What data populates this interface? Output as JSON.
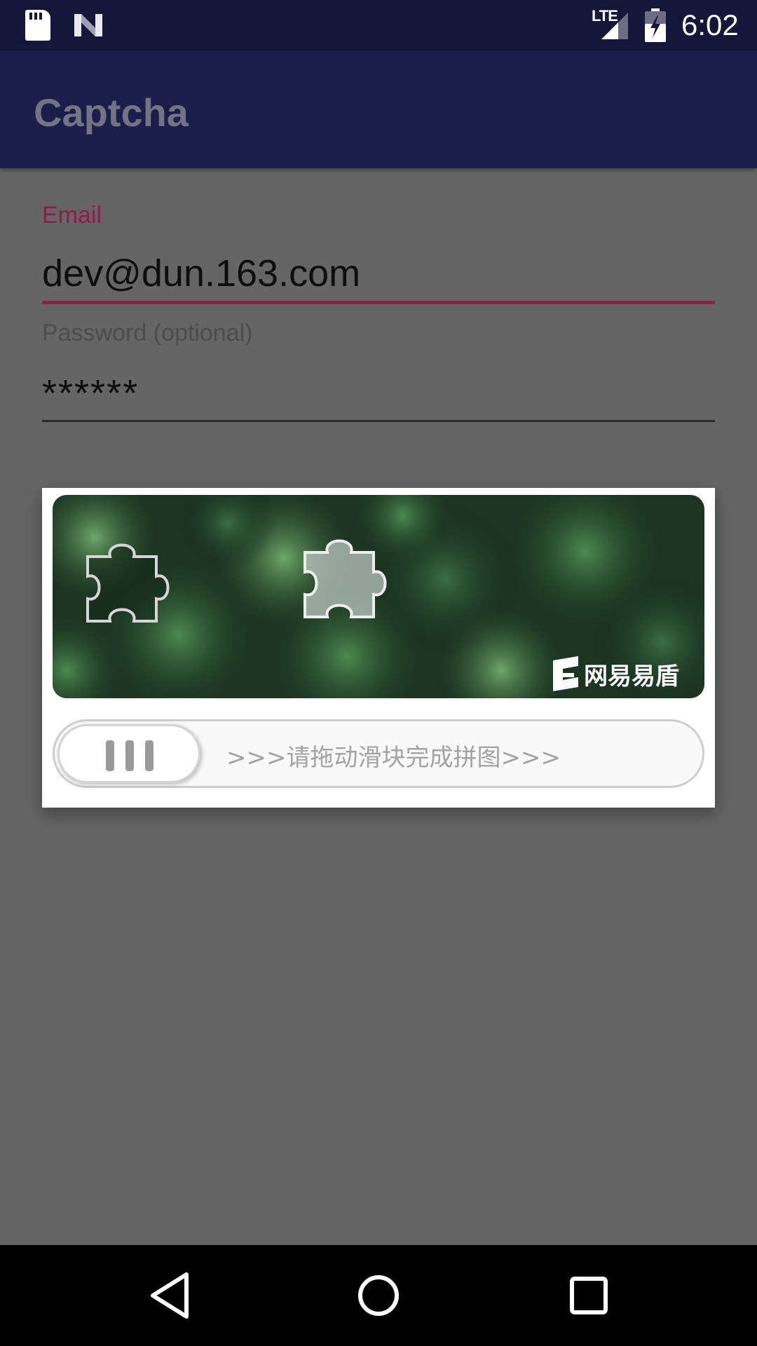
{
  "status_bar": {
    "network": "LTE",
    "time": "6:02",
    "icons": [
      "sd-card-icon",
      "n-logo-icon",
      "signal-icon",
      "battery-icon"
    ]
  },
  "app_bar": {
    "title": "Captcha"
  },
  "form": {
    "email_label": "Email",
    "email_value": "dev@dun.163.com",
    "password_label": "Password (optional)",
    "password_value": "******"
  },
  "captcha": {
    "brand": "网易易盾",
    "slider_hint": ">>>请拖动滑块完成拼图>>>",
    "slider_progress": 0
  },
  "nav_bar": {
    "buttons": [
      "back-icon",
      "home-icon",
      "recents-icon"
    ]
  },
  "colors": {
    "status_bar": "#14163a",
    "app_bar": "#1a1e48",
    "accent": "#8f1d45",
    "scrim": "#656565"
  }
}
